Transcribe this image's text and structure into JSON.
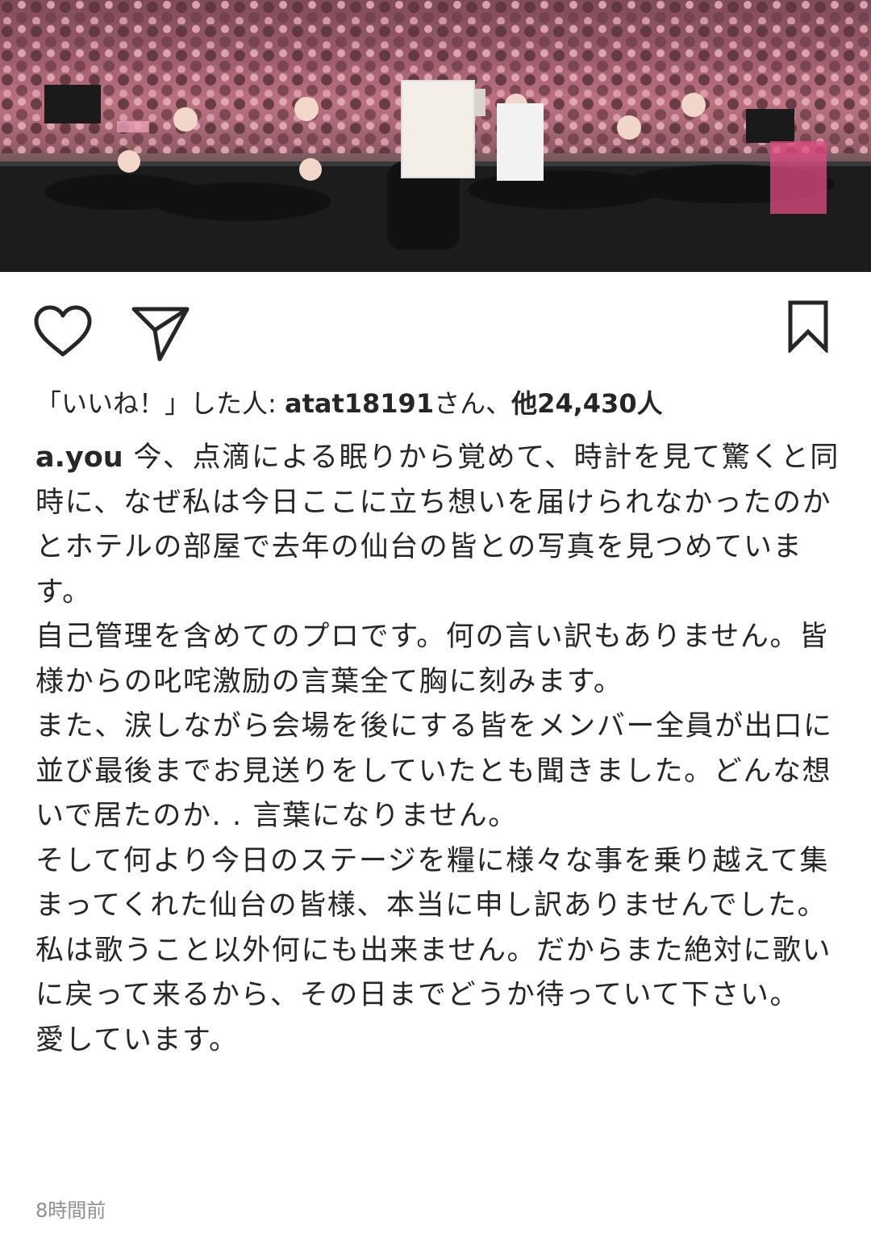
{
  "post": {
    "image_icon": "concert-group-photo",
    "actions": {
      "like_icon": "heart-icon",
      "share_icon": "paper-plane-icon",
      "save_icon": "bookmark-icon"
    },
    "likes": {
      "prefix": "「いいね！」した人: ",
      "first_user": "atat18191",
      "middle": "さん、",
      "others": "他24,430人"
    },
    "caption": {
      "username": "a.you",
      "first_text": " 今、点滴による眠りから覚めて、時計を見て驚くと同時に、なぜ私は今日ここに立ち想いを届けられなかったのかとホテルの部屋で去年の仙台の皆との写真を見つめています。",
      "paragraphs": [
        "自己管理を含めてのプロです。何の言い訳もありません。皆様からの叱咤激励の言葉全て胸に刻みます。",
        "また、涙しながら会場を後にする皆をメンバー全員が出口に並び最後までお見送りをしていたとも聞きました。どんな想いで居たのか. . 言葉になりません。",
        "そして何より今日のステージを糧に様々な事を乗り越えて集まってくれた仙台の皆様、本当に申し訳ありませんでした。私は歌うこと以外何にも出来ません。だからまた絶対に歌いに戻って来るから、その日までどうか待っていて下さい。",
        "愛しています。"
      ]
    },
    "timestamp": "8時間前"
  }
}
